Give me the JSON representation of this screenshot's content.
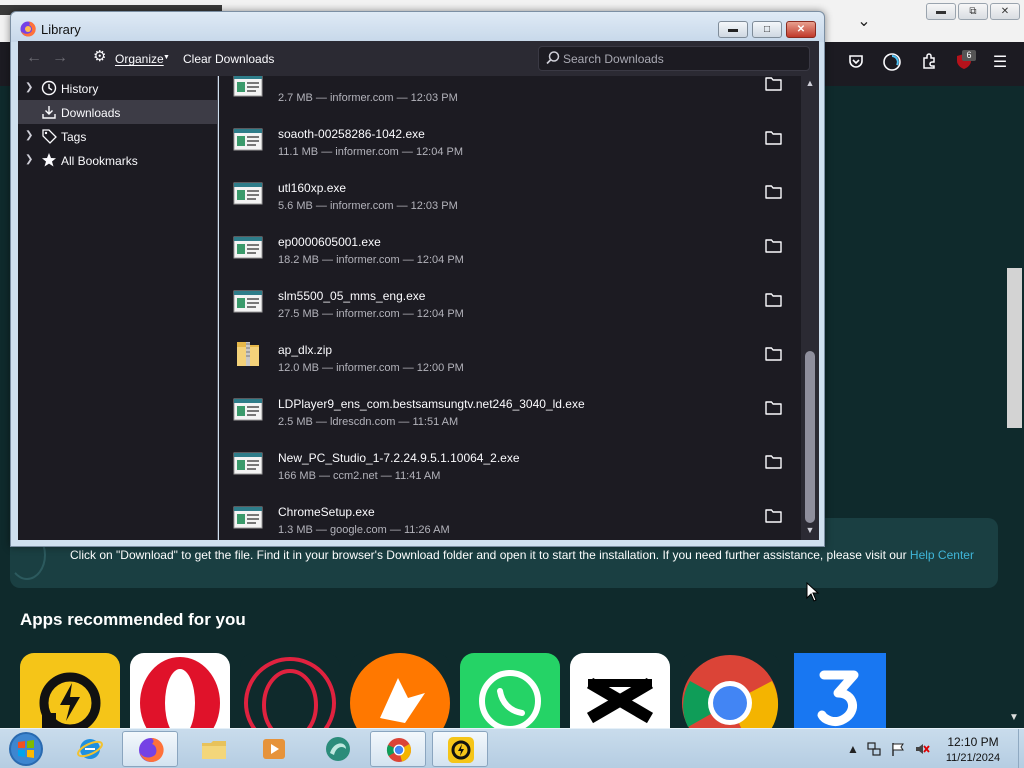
{
  "window": {
    "title": "Library"
  },
  "toolbar": {
    "organize_label": "Organize",
    "clear_label": "Clear Downloads",
    "search_placeholder": "Search Downloads"
  },
  "sidebar": {
    "items": [
      {
        "label": "History"
      },
      {
        "label": "Downloads"
      },
      {
        "label": "Tags"
      },
      {
        "label": "All Bookmarks"
      }
    ]
  },
  "downloads": [
    {
      "name": "",
      "meta": "2.7 MB — informer.com — 12:03 PM",
      "icon": "setup-exe-icon"
    },
    {
      "name": "soaoth-00258286-1042.exe",
      "meta": "11.1 MB — informer.com — 12:04 PM",
      "icon": "setup-exe-icon"
    },
    {
      "name": "utl160xp.exe",
      "meta": "5.6 MB — informer.com — 12:03 PM",
      "icon": "setup-exe-icon"
    },
    {
      "name": "ep0000605001.exe",
      "meta": "18.2 MB — informer.com — 12:04 PM",
      "icon": "setup-exe-icon"
    },
    {
      "name": "slm5500_05_mms_eng.exe",
      "meta": "27.5 MB — informer.com — 12:04 PM",
      "icon": "setup-exe-icon"
    },
    {
      "name": "ap_dlx.zip",
      "meta": "12.0 MB — informer.com — 12:00 PM",
      "icon": "zip-folder-icon"
    },
    {
      "name": "LDPlayer9_ens_com.bestsamsungtv.net246_3040_ld.exe",
      "meta": "2.5 MB — ldrescdn.com — 11:51 AM",
      "icon": "setup-exe-icon"
    },
    {
      "name": "New_PC_Studio_1-7.2.24.9.5.1.10064_2.exe",
      "meta": "166 MB — ccm2.net — 11:41 AM",
      "icon": "setup-exe-icon"
    },
    {
      "name": "ChromeSetup.exe",
      "meta": "1.3 MB — google.com — 11:26 AM",
      "icon": "setup-exe-icon"
    }
  ],
  "page": {
    "info_text": "Click on \"Download\" to get the file. Find it in your browser's Download folder and open it to start the installation. If you need further assistance, please visit our ",
    "help_link": "Help Center",
    "apps_title": "Apps recommended for you"
  },
  "browser": {
    "extension_badge": "6"
  },
  "taskbar": {
    "time": "12:10 PM",
    "date": "11/21/2024"
  },
  "colors": {
    "page_bg": "#0f2a2c",
    "link": "#3fb5d8",
    "dark_panel": "#1c1b22",
    "toolbar": "#2b2a33"
  }
}
